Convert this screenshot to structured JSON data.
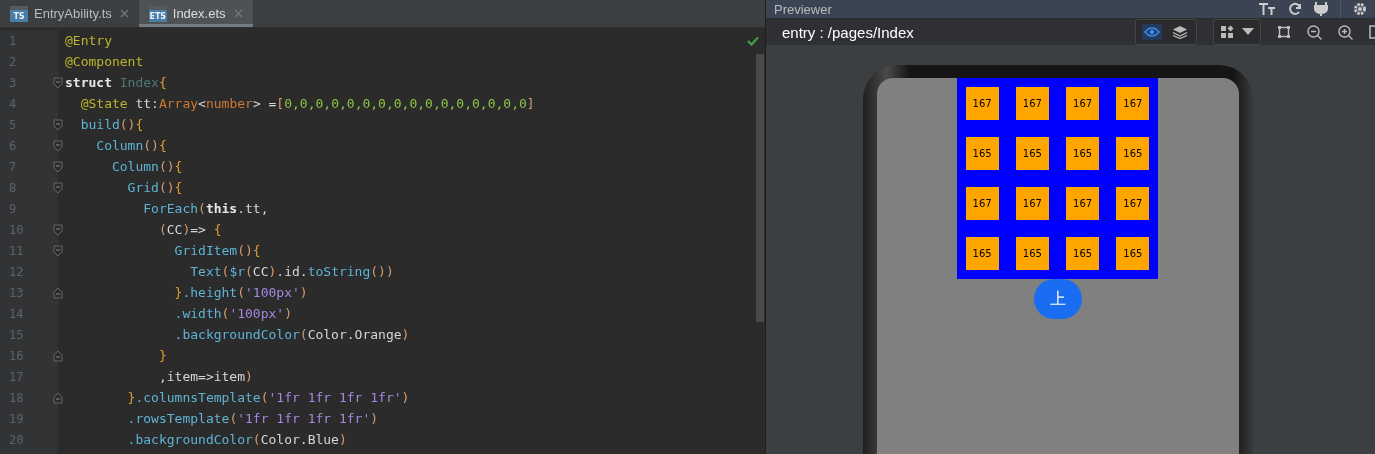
{
  "tabs": [
    {
      "label": "EntryAbility.ts",
      "icon_text": "TS",
      "selected": false
    },
    {
      "label": "Index.ets",
      "icon_text": "ETS",
      "selected": true
    }
  ],
  "editor": {
    "lines": [
      {
        "number": "1",
        "tokens": [
          {
            "text": "@Entry",
            "kind": "ann"
          }
        ]
      },
      {
        "number": "2",
        "tokens": [
          {
            "text": "@Component",
            "kind": "ann"
          }
        ]
      },
      {
        "number": "3",
        "fold_open": true,
        "tokens": [
          {
            "text": "struct",
            "kind": "kw"
          },
          {
            "text": " Index",
            "kind": "cls"
          },
          {
            "text": "{",
            "kind": "brace"
          }
        ]
      },
      {
        "number": "4",
        "tokens": [
          {
            "text": "  @State",
            "kind": "ann"
          },
          {
            "text": " tt:",
            "kind": "plain"
          },
          {
            "text": "Array",
            "kind": "type"
          },
          {
            "text": "<",
            "kind": "plain"
          },
          {
            "text": "number",
            "kind": "type"
          },
          {
            "text": "> =",
            "kind": "plain"
          },
          {
            "text": "[",
            "kind": "paren"
          },
          {
            "text": "0,0,0,0,0,0,0,0,0,0,0,0,0,0,0,0",
            "kind": "num"
          },
          {
            "text": "]",
            "kind": "paren"
          }
        ]
      },
      {
        "number": "5",
        "fold_open": true,
        "tokens": [
          {
            "text": "  build",
            "kind": "func"
          },
          {
            "text": "()",
            "kind": "paren"
          },
          {
            "text": "{",
            "kind": "brace"
          }
        ]
      },
      {
        "number": "6",
        "fold_open": true,
        "tokens": [
          {
            "text": "    Column",
            "kind": "func"
          },
          {
            "text": "()",
            "kind": "paren"
          },
          {
            "text": "{",
            "kind": "brace"
          }
        ]
      },
      {
        "number": "7",
        "fold_open": true,
        "tokens": [
          {
            "text": "      Column",
            "kind": "func"
          },
          {
            "text": "()",
            "kind": "paren"
          },
          {
            "text": "{",
            "kind": "brace"
          }
        ]
      },
      {
        "number": "8",
        "fold_open": true,
        "tokens": [
          {
            "text": "        Grid",
            "kind": "func"
          },
          {
            "text": "()",
            "kind": "paren"
          },
          {
            "text": "{",
            "kind": "brace"
          }
        ]
      },
      {
        "number": "9",
        "tokens": [
          {
            "text": "          ForEach",
            "kind": "func"
          },
          {
            "text": "(",
            "kind": "paren"
          },
          {
            "text": "this",
            "kind": "kw"
          },
          {
            "text": ".tt,",
            "kind": "plain"
          }
        ]
      },
      {
        "number": "10",
        "fold_open": true,
        "tokens": [
          {
            "text": "            (",
            "kind": "paren"
          },
          {
            "text": "CC",
            "kind": "plain"
          },
          {
            "text": ")",
            "kind": "paren"
          },
          {
            "text": "=> ",
            "kind": "plain"
          },
          {
            "text": "{",
            "kind": "brace"
          }
        ]
      },
      {
        "number": "11",
        "fold_open": true,
        "tokens": [
          {
            "text": "              GridItem",
            "kind": "func"
          },
          {
            "text": "()",
            "kind": "paren"
          },
          {
            "text": "{",
            "kind": "brace"
          }
        ]
      },
      {
        "number": "12",
        "tokens": [
          {
            "text": "                Text",
            "kind": "func"
          },
          {
            "text": "(",
            "kind": "paren"
          },
          {
            "text": "$r",
            "kind": "func"
          },
          {
            "text": "(",
            "kind": "paren"
          },
          {
            "text": "CC",
            "kind": "plain"
          },
          {
            "text": ")",
            "kind": "paren"
          },
          {
            "text": ".id.",
            "kind": "plain"
          },
          {
            "text": "toString",
            "kind": "func"
          },
          {
            "text": "())",
            "kind": "paren"
          }
        ]
      },
      {
        "number": "13",
        "fold_close": true,
        "tokens": [
          {
            "text": "              }",
            "kind": "brace"
          },
          {
            "text": ".height",
            "kind": "func"
          },
          {
            "text": "(",
            "kind": "paren"
          },
          {
            "text": "'100px'",
            "kind": "str"
          },
          {
            "text": ")",
            "kind": "paren"
          }
        ]
      },
      {
        "number": "14",
        "tokens": [
          {
            "text": "              .width",
            "kind": "func"
          },
          {
            "text": "(",
            "kind": "paren"
          },
          {
            "text": "'100px'",
            "kind": "str"
          },
          {
            "text": ")",
            "kind": "paren"
          }
        ]
      },
      {
        "number": "15",
        "tokens": [
          {
            "text": "              .backgroundColor",
            "kind": "func"
          },
          {
            "text": "(",
            "kind": "paren"
          },
          {
            "text": "Color.Orange",
            "kind": "plain"
          },
          {
            "text": ")",
            "kind": "paren"
          }
        ]
      },
      {
        "number": "16",
        "fold_close": true,
        "tokens": [
          {
            "text": "            }",
            "kind": "brace"
          }
        ]
      },
      {
        "number": "17",
        "tokens": [
          {
            "text": "            ,item=>item",
            "kind": "plain"
          },
          {
            "text": ")",
            "kind": "paren"
          }
        ]
      },
      {
        "number": "18",
        "fold_close": true,
        "tokens": [
          {
            "text": "        }",
            "kind": "brace"
          },
          {
            "text": ".columnsTemplate",
            "kind": "func"
          },
          {
            "text": "(",
            "kind": "paren"
          },
          {
            "text": "'1fr 1fr 1fr 1fr'",
            "kind": "str"
          },
          {
            "text": ")",
            "kind": "paren"
          }
        ]
      },
      {
        "number": "19",
        "tokens": [
          {
            "text": "        .rowsTemplate",
            "kind": "func"
          },
          {
            "text": "(",
            "kind": "paren"
          },
          {
            "text": "'1fr 1fr 1fr 1fr'",
            "kind": "str"
          },
          {
            "text": ")",
            "kind": "paren"
          }
        ]
      },
      {
        "number": "20",
        "tokens": [
          {
            "text": "        .backgroundColor",
            "kind": "func"
          },
          {
            "text": "(",
            "kind": "paren"
          },
          {
            "text": "Color.Blue",
            "kind": "plain"
          },
          {
            "text": ")",
            "kind": "paren"
          }
        ]
      }
    ]
  },
  "previewer": {
    "title": "Previewer",
    "path": "entry : /pages/Index",
    "view_toggles": [
      {
        "kind": "eye",
        "selected": true
      },
      {
        "kind": "layers",
        "selected": false
      }
    ],
    "device": {
      "grid": [
        "167",
        "167",
        "167",
        "167",
        "165",
        "165",
        "165",
        "165",
        "167",
        "167",
        "167",
        "167",
        "165",
        "165",
        "165",
        "165"
      ],
      "button": "上"
    }
  }
}
